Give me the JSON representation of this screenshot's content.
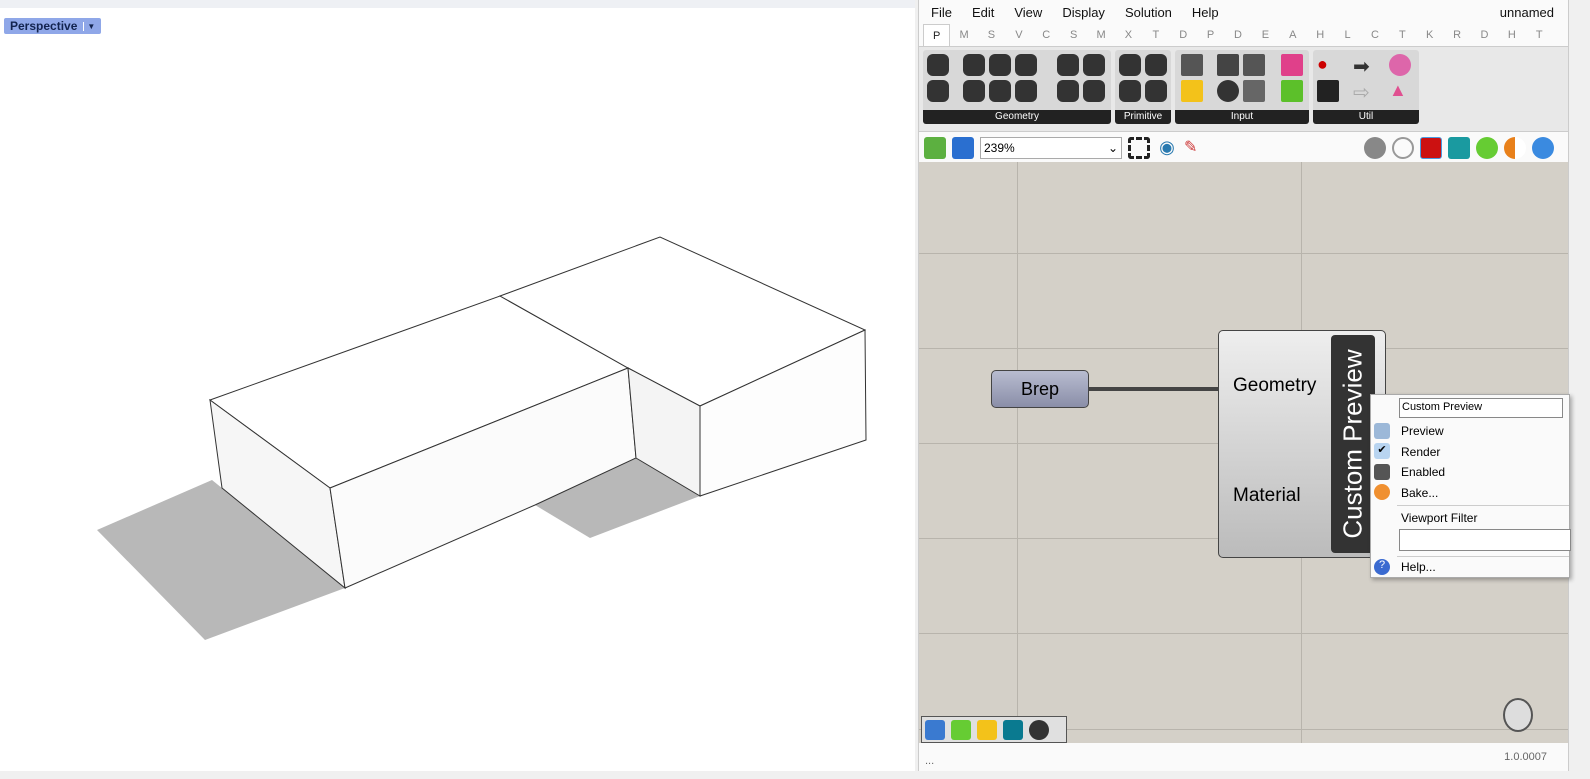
{
  "viewport": {
    "name": "Perspective"
  },
  "menu": [
    "File",
    "Edit",
    "View",
    "Display",
    "Solution",
    "Help"
  ],
  "doc_title": "unnamed",
  "tabs": [
    "P",
    "M",
    "S",
    "V",
    "C",
    "S",
    "M",
    "X",
    "T",
    "D",
    "P",
    "D",
    "E",
    "A",
    "H",
    "L",
    "C",
    "T",
    "K",
    "R",
    "D",
    "H",
    "T"
  ],
  "ribbon_groups": [
    "Geometry",
    "Primitive",
    "Input",
    "Util"
  ],
  "zoom": "239%",
  "nodes": {
    "brep": "Brep",
    "custom_preview": "Custom Preview",
    "inputs": [
      "Geometry",
      "Material"
    ]
  },
  "context_menu": {
    "name_value": "Custom Preview",
    "items": [
      "Preview",
      "Render",
      "Enabled",
      "Bake..."
    ],
    "filter_label": "Viewport Filter",
    "filter_value": "",
    "help": "Help..."
  },
  "status": {
    "left": "...",
    "version": "1.0.0007"
  }
}
